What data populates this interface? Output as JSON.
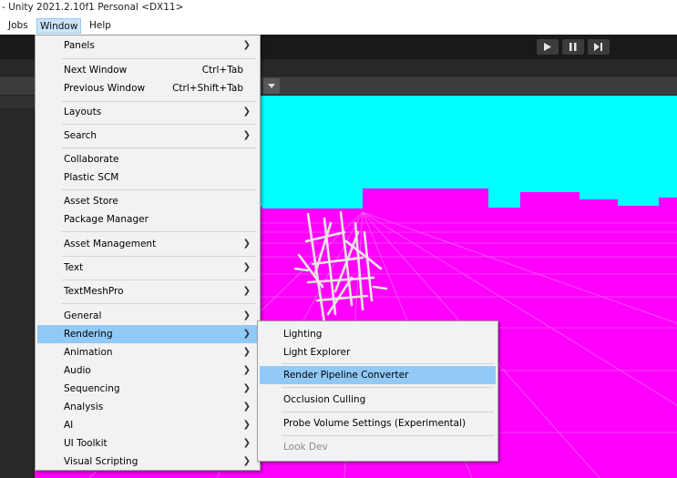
{
  "window": {
    "title": "- Unity 2021.2.10f1 Personal <DX11>"
  },
  "menubar": {
    "items": [
      {
        "label": "Jobs"
      },
      {
        "label": "Window"
      },
      {
        "label": "Help"
      }
    ]
  },
  "toolbar": {
    "play_icon": "play-icon",
    "pause_icon": "pause-icon",
    "step_icon": "step-icon"
  },
  "window_menu": {
    "panels": "Panels",
    "next_window": "Next Window",
    "next_window_shortcut": "Ctrl+Tab",
    "previous_window": "Previous Window",
    "previous_window_shortcut": "Ctrl+Shift+Tab",
    "layouts": "Layouts",
    "search": "Search",
    "collaborate": "Collaborate",
    "plastic_scm": "Plastic SCM",
    "asset_store": "Asset Store",
    "package_manager": "Package Manager",
    "asset_management": "Asset Management",
    "text": "Text",
    "textmeshpro": "TextMeshPro",
    "general": "General",
    "rendering": "Rendering",
    "animation": "Animation",
    "audio": "Audio",
    "sequencing": "Sequencing",
    "analysis": "Analysis",
    "ai": "AI",
    "ui_toolkit": "UI Toolkit",
    "visual_scripting": "Visual Scripting"
  },
  "rendering_menu": {
    "lighting": "Lighting",
    "light_explorer": "Light Explorer",
    "render_pipeline_converter": "Render Pipeline Converter",
    "occlusion_culling": "Occlusion Culling",
    "probe_volume_settings": "Probe Volume Settings (Experimental)",
    "look_dev": "Look Dev"
  },
  "colors": {
    "sky": "#00ffff",
    "ground": "#ff00ff",
    "menu_highlight": "#91c9f7",
    "menu_background": "#f2f2f2"
  }
}
